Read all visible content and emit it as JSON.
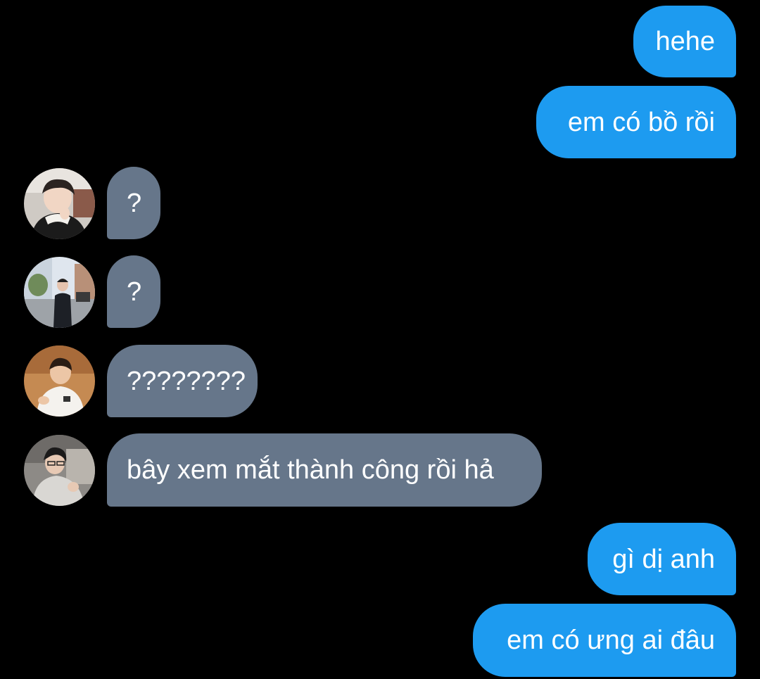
{
  "messages": {
    "m1": {
      "text": "hehe",
      "sender": "me"
    },
    "m2": {
      "text": "em có bồ rồi",
      "sender": "me"
    },
    "m3": {
      "text": "?",
      "sender": "other"
    },
    "m4": {
      "text": "?",
      "sender": "other"
    },
    "m5": {
      "text": "????????",
      "sender": "other"
    },
    "m6": {
      "text": "bây xem mắt thành công rồi hả",
      "sender": "other"
    },
    "m7": {
      "text": "gì dị anh",
      "sender": "me"
    },
    "m8": {
      "text": "em có ưng ai đâu",
      "sender": "me"
    }
  },
  "colors": {
    "background": "#000000",
    "sent_bubble": "#1d9bf0",
    "received_bubble": "#66768a",
    "text": "#ffffff"
  },
  "icons": {
    "avatar1": "profile-photo-person-with-hand-on-chin",
    "avatar2": "profile-photo-person-standing-on-street",
    "avatar3": "profile-photo-person-in-white-hoodie",
    "avatar4": "profile-photo-person-with-glasses"
  }
}
